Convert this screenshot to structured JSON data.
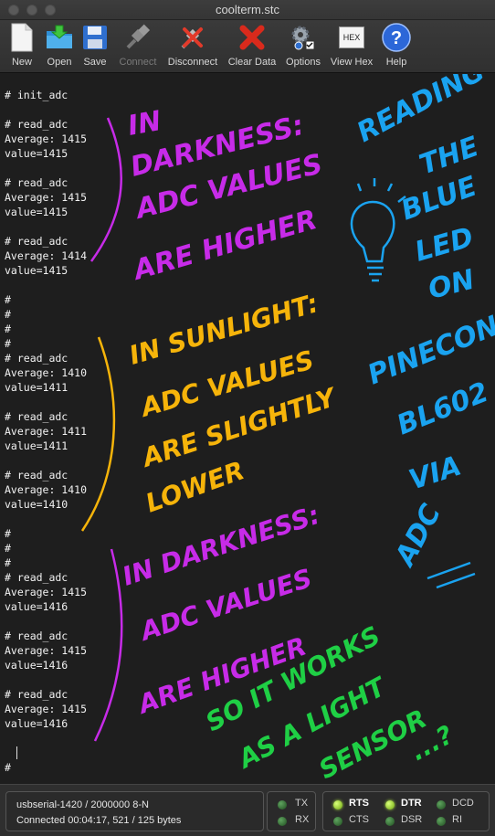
{
  "window": {
    "title": "coolterm.stc"
  },
  "toolbar": {
    "new": "New",
    "open": "Open",
    "save": "Save",
    "connect": "Connect",
    "disconnect": "Disconnect",
    "clear_data": "Clear Data",
    "options": "Options",
    "view_hex": "View Hex",
    "help": "Help",
    "hex_icon_text": "HEX"
  },
  "terminal": {
    "lines": [
      "# init_adc",
      "",
      "# read_adc",
      "Average: 1415",
      "value=1415",
      "",
      "# read_adc",
      "Average: 1415",
      "value=1415",
      "",
      "# read_adc",
      "Average: 1414",
      "value=1415",
      "",
      "#",
      "#",
      "#",
      "#",
      "# read_adc",
      "Average: 1410",
      "value=1411",
      "",
      "# read_adc",
      "Average: 1411",
      "value=1411",
      "",
      "# read_adc",
      "Average: 1410",
      "value=1410",
      "",
      "#",
      "#",
      "#",
      "# read_adc",
      "Average: 1415",
      "value=1416",
      "",
      "# read_adc",
      "Average: 1415",
      "value=1416",
      "",
      "# read_adc",
      "Average: 1415",
      "value=1416",
      "",
      "",
      "# "
    ]
  },
  "annotations": {
    "darkness1": [
      "IN",
      "DARKNESS:",
      "ADC VALUES",
      "ARE HIGHER"
    ],
    "sunlight": [
      "IN SUNLIGHT:",
      "ADC VALUES",
      "ARE SLIGHTLY",
      "LOWER"
    ],
    "darkness2": [
      "IN DARKNESS:",
      "ADC VALUES",
      "ARE HIGHER"
    ],
    "conclusion": [
      "SO IT WORKS",
      "AS A LIGHT",
      "SENSOR",
      "...?"
    ],
    "side": [
      "READING",
      "THE",
      "BLUE",
      "LED",
      "ON",
      "PINECONE",
      "BL602",
      "VIA",
      "ADC"
    ],
    "colors": {
      "purple": "#c72be8",
      "orange": "#f6b40a",
      "blue": "#1aa3f0",
      "green": "#1fcf45"
    }
  },
  "status": {
    "port": "usbserial-1420 / 2000000 8-N",
    "connection": "Connected 00:04:17, 521 / 125 bytes",
    "leds": [
      {
        "label": "TX",
        "on": false
      },
      {
        "label": "RX",
        "on": false
      },
      {
        "label": "RTS",
        "on": true
      },
      {
        "label": "CTS",
        "on": false
      },
      {
        "label": "DTR",
        "on": true
      },
      {
        "label": "DSR",
        "on": false
      },
      {
        "label": "DCD",
        "on": false
      },
      {
        "label": "RI",
        "on": false
      }
    ]
  }
}
